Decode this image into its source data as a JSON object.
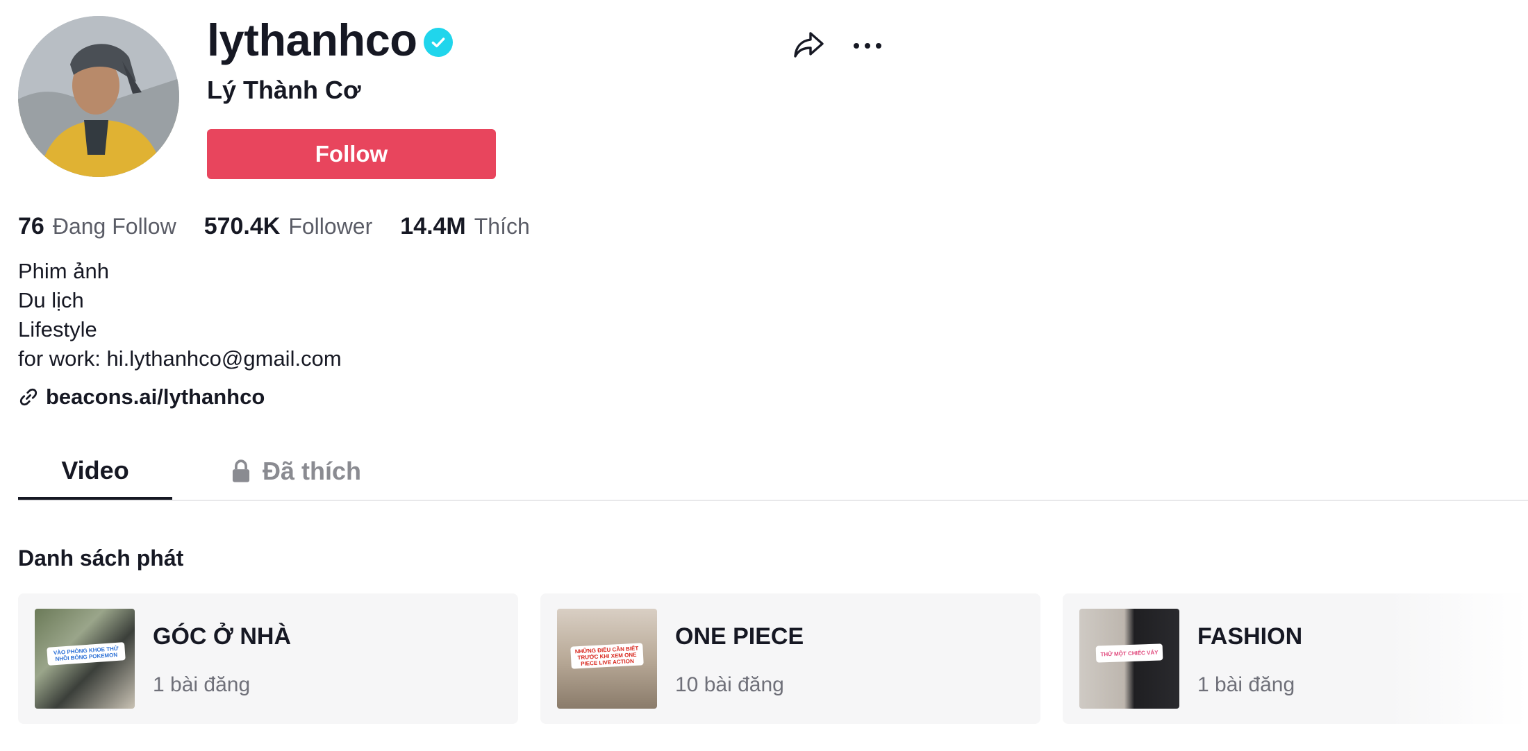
{
  "profile": {
    "username": "lythanhco",
    "display_name": "Lý Thành Cơ",
    "verified": true,
    "follow_label": "Follow"
  },
  "stats": [
    {
      "value": "76",
      "label": "Đang Follow"
    },
    {
      "value": "570.4K",
      "label": "Follower"
    },
    {
      "value": "14.4M",
      "label": "Thích"
    }
  ],
  "bio": {
    "lines": [
      "Phim ảnh",
      "Du lịch",
      "Lifestyle",
      "for work: hi.lythanhco@gmail.com"
    ],
    "link": "beacons.ai/lythanhco"
  },
  "tabs": [
    {
      "label": "Video",
      "active": true
    },
    {
      "label": "Đã thích",
      "active": false,
      "locked": true
    }
  ],
  "playlists": {
    "title": "Danh sách phát",
    "items": [
      {
        "title": "GÓC Ở NHÀ",
        "count": "1 bài đăng",
        "thumb_text": "VÀO PHÒNG KHOE THỬ NHỒI BÔNG POKEMON"
      },
      {
        "title": "ONE PIECE",
        "count": "10 bài đăng",
        "thumb_text": "NHỮNG ĐIỀU CẦN BIẾT TRƯỚC KHI XEM ONE PIECE LIVE ACTION"
      },
      {
        "title": "FASHION",
        "count": "1 bài đăng",
        "thumb_text": "THỬ MỘT CHIẾC VÁY"
      }
    ]
  },
  "colors": {
    "follow_button": "#e8455d",
    "verified_badge": "#20d5ec",
    "text_primary": "#161823",
    "text_secondary": "#5a5c66"
  },
  "icons": {
    "verified": "verified-check-icon",
    "share": "share-icon",
    "more": "more-options-icon",
    "link": "link-icon",
    "lock": "lock-icon"
  }
}
